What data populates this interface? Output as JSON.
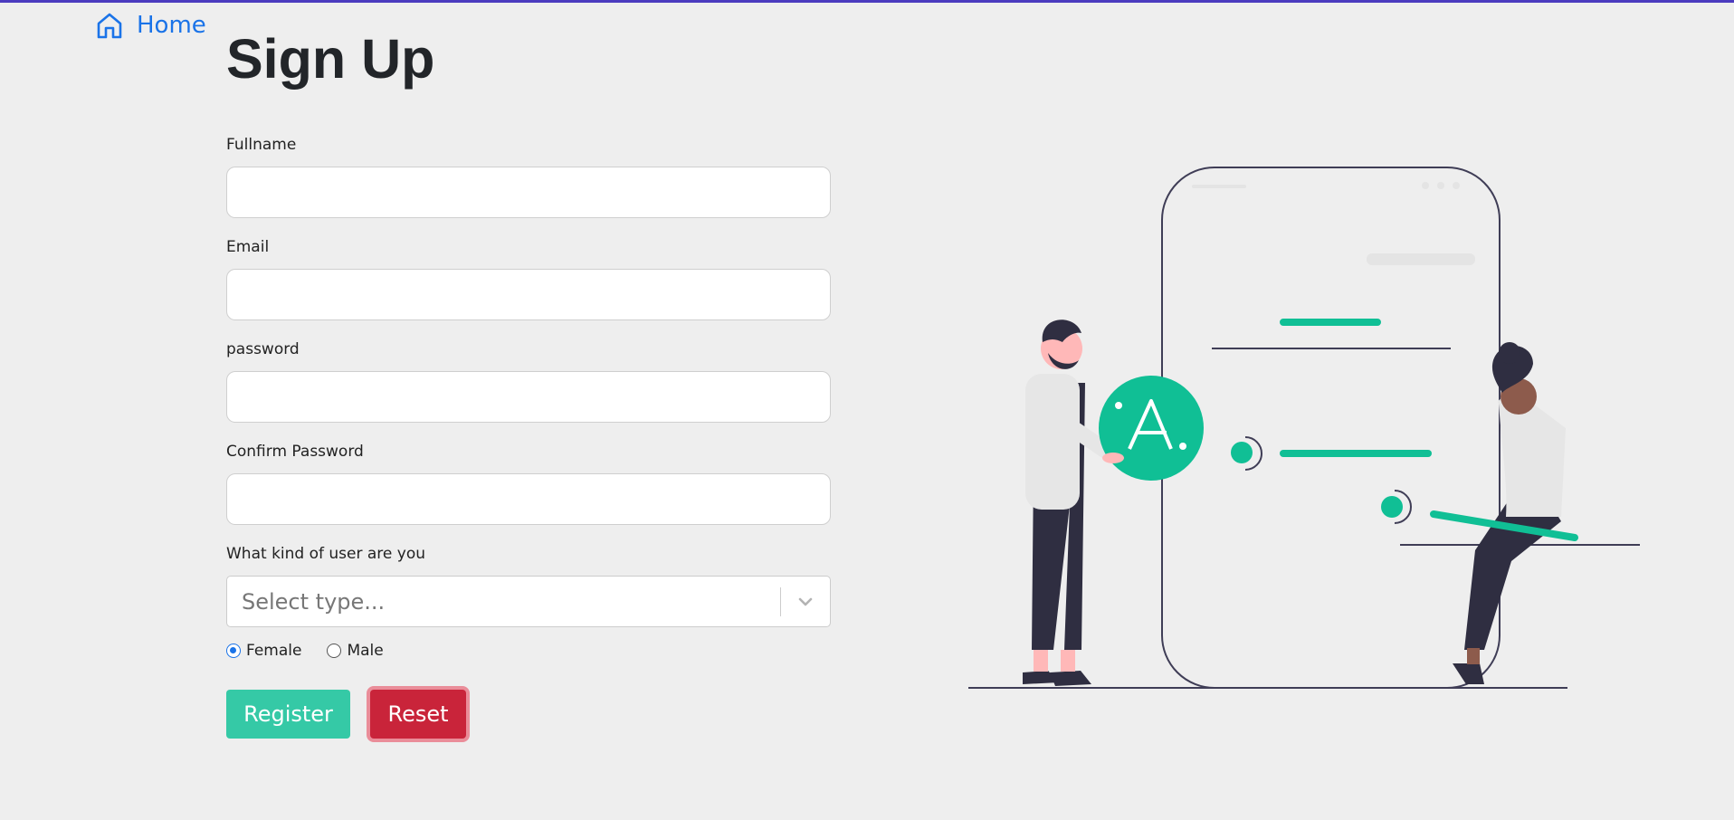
{
  "nav": {
    "home_label": "Home"
  },
  "page": {
    "title": "Sign Up"
  },
  "form": {
    "fullname": {
      "label": "Fullname",
      "value": ""
    },
    "email": {
      "label": "Email",
      "value": ""
    },
    "password": {
      "label": "password",
      "value": ""
    },
    "confirm_password": {
      "label": "Confirm Password",
      "value": ""
    },
    "user_type": {
      "label": "What kind of user are you",
      "placeholder": "Select type..."
    },
    "gender": {
      "options": [
        "Female",
        "Male"
      ],
      "selected": "Female"
    },
    "register_label": "Register",
    "reset_label": "Reset"
  },
  "colors": {
    "accent": "#1a73e8",
    "register": "#35c9a6",
    "reset": "#c9243a",
    "illustration_green": "#10bf95",
    "topbar": "#4b3bbf"
  },
  "illustration": {
    "badge_text": "A."
  }
}
